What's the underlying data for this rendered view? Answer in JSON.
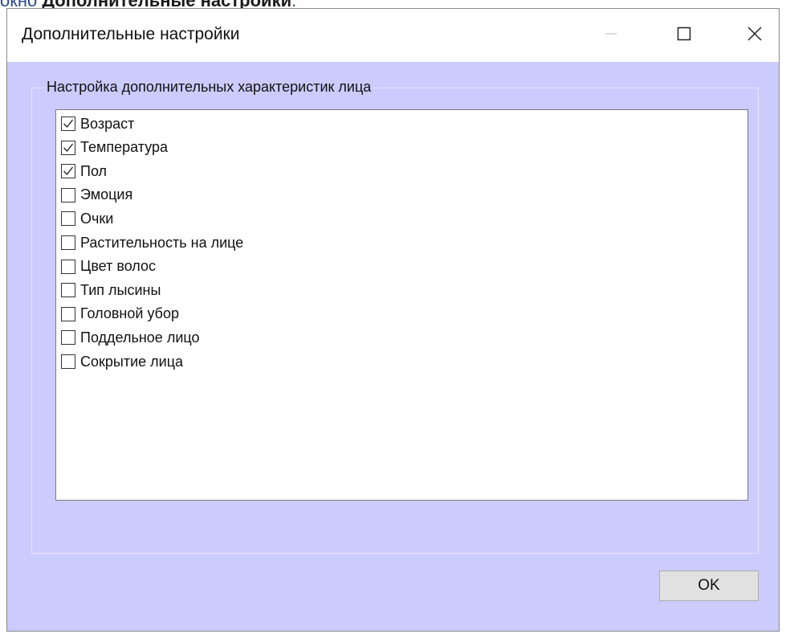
{
  "caption": {
    "prefix": "окно ",
    "bold": "Дополнительные настройки",
    "suffix": "."
  },
  "window": {
    "title": "Дополнительные настройки",
    "controls": {
      "minimize_icon": "minimize-icon",
      "maximize_icon": "maximize-icon",
      "close_icon": "close-icon"
    }
  },
  "group": {
    "title": "Настройка дополнительных характеристик лица",
    "items": [
      {
        "label": "Возраст",
        "checked": true
      },
      {
        "label": "Температура",
        "checked": true
      },
      {
        "label": "Пол",
        "checked": true
      },
      {
        "label": "Эмоция",
        "checked": false
      },
      {
        "label": "Очки",
        "checked": false
      },
      {
        "label": "Растительность на лице",
        "checked": false
      },
      {
        "label": "Цвет волос",
        "checked": false
      },
      {
        "label": "Тип лысины",
        "checked": false
      },
      {
        "label": "Головной убор",
        "checked": false
      },
      {
        "label": "Поддельное лицо",
        "checked": false
      },
      {
        "label": "Сокрытие лица",
        "checked": false
      }
    ]
  },
  "buttons": {
    "ok_label": "OK"
  },
  "colors": {
    "client_background": "#cccbfe",
    "titlebar": "#ffffff",
    "list_background": "#ffffff",
    "button_face": "#e1e1e1"
  }
}
